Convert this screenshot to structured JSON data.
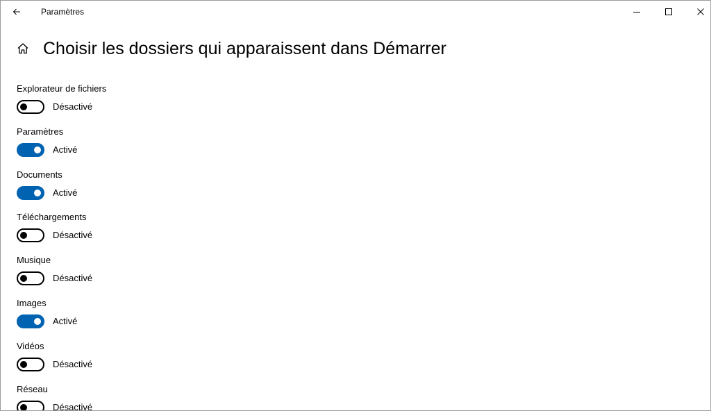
{
  "window": {
    "app_title": "Paramètres",
    "back_icon": "arrow-left-icon",
    "minimize_icon": "minimize-icon",
    "maximize_icon": "maximize-icon",
    "close_icon": "close-icon"
  },
  "page": {
    "home_icon": "home-icon",
    "title": "Choisir les dossiers qui apparaissent dans Démarrer"
  },
  "colors": {
    "accent": "#0063b1",
    "toggle_off": "#000000",
    "background": "#ffffff"
  },
  "settings": [
    {
      "label": "Explorateur de fichiers",
      "on": false,
      "state": "Désactivé"
    },
    {
      "label": "Paramètres",
      "on": true,
      "state": "Activé"
    },
    {
      "label": "Documents",
      "on": true,
      "state": "Activé"
    },
    {
      "label": "Téléchargements",
      "on": false,
      "state": "Désactivé"
    },
    {
      "label": "Musique",
      "on": false,
      "state": "Désactivé"
    },
    {
      "label": "Images",
      "on": true,
      "state": "Activé"
    },
    {
      "label": "Vidéos",
      "on": false,
      "state": "Désactivé"
    },
    {
      "label": "Réseau",
      "on": false,
      "state": "Désactivé"
    }
  ]
}
